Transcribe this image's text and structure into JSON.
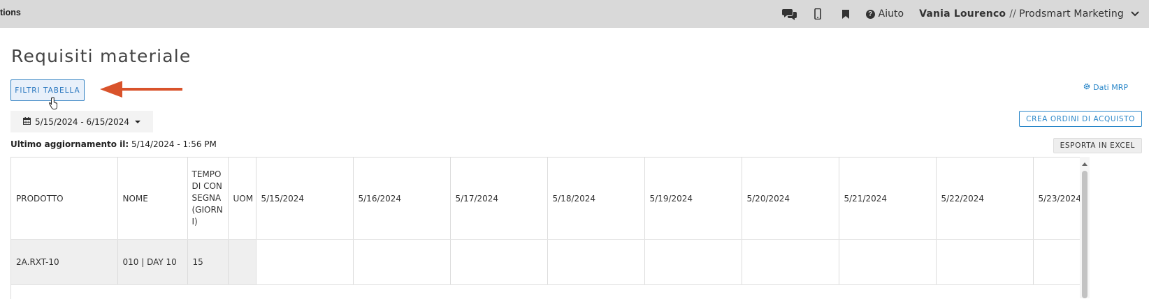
{
  "topbar": {
    "left_text": "tions",
    "icons": [
      "chat-icon",
      "mobile-icon",
      "bookmark-icon",
      "help-icon"
    ],
    "help_label": "Aiuto",
    "user_name": "Vania Lourenco",
    "separator": "//",
    "company": "Prodsmart Marketing"
  },
  "page": {
    "title": "Requisiti materiale",
    "filter_button": "FILTRI TABELLA",
    "dati_mrp_link": "Dati MRP",
    "date_range": "5/15/2024 - 6/15/2024",
    "create_orders_button": "CREA ORDINI DI ACQUISTO",
    "last_update_label": "Ultimo aggiornamento il:",
    "last_update_value": "5/14/2024 - 1:56 PM",
    "export_button": "ESPORTA IN EXCEL"
  },
  "table": {
    "headers": [
      "PRODOTTO",
      "NOME",
      "TEMPO DI CONSEGNA (GIORNI)",
      "UOM",
      "5/15/2024",
      "5/16/2024",
      "5/17/2024",
      "5/18/2024",
      "5/19/2024",
      "5/20/2024",
      "5/21/2024",
      "5/22/2024",
      "5/23/2024"
    ],
    "rows": [
      [
        "2A.RXT-10",
        "010 | DAY 10",
        "15",
        "",
        "",
        "",
        "",
        "",
        "",
        "",
        "",
        "",
        ""
      ]
    ]
  },
  "colors": {
    "accent": "#2a87c9",
    "annotation_arrow": "#d9532b",
    "topbar_bg": "#d9d9d9"
  }
}
